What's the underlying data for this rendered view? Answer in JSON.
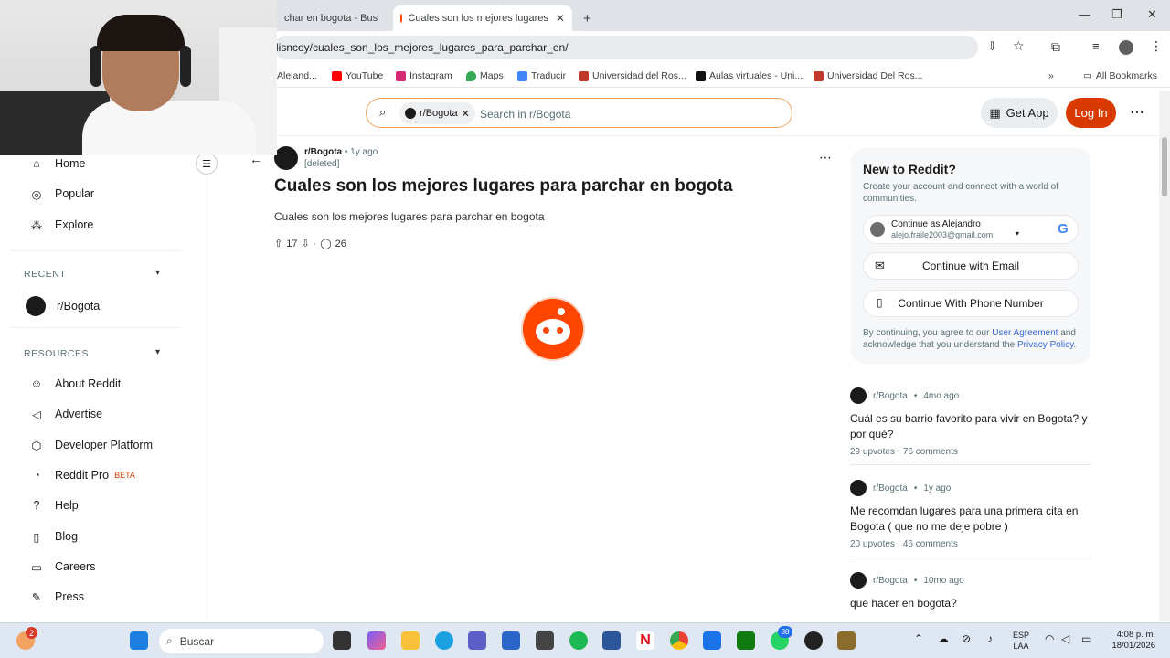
{
  "browser": {
    "tabs": [
      {
        "title": "char en bogota - Bus"
      },
      {
        "title": "Cuales son los mejores lugares"
      }
    ],
    "new_tab": "+",
    "url": "lisncoy/cuales_son_los_mejores_lugares_para_parchar_en/",
    "bookmarks": [
      {
        "label": "Alejand...",
        "color": "#777777"
      },
      {
        "label": "YouTube",
        "color": "#ff0000"
      },
      {
        "label": "Instagram",
        "color": "#d62976"
      },
      {
        "label": "Maps",
        "color": "#34a853"
      },
      {
        "label": "Traducir",
        "color": "#4285f4"
      },
      {
        "label": "Universidad del Ros...",
        "color": "#c0392b"
      },
      {
        "label": "Aulas virtuales - Uni...",
        "color": "#111111"
      },
      {
        "label": "Universidad Del Ros...",
        "color": "#c0392b"
      }
    ],
    "all_bookmarks": "All Bookmarks"
  },
  "reddit_header": {
    "community_chip": "r/Bogota",
    "search_placeholder": "Search in r/Bogota",
    "get_app": "Get App",
    "login": "Log In"
  },
  "sidebar": {
    "top_items": [
      {
        "label": "Home",
        "icon": "home-icon"
      },
      {
        "label": "Popular",
        "icon": "popular-icon"
      },
      {
        "label": "Explore",
        "icon": "explore-icon"
      }
    ],
    "recent_header": "RECENT",
    "recent_items": [
      {
        "label": "r/Bogota"
      }
    ],
    "resources_header": "RESOURCES",
    "resource_items": [
      {
        "label": "About Reddit"
      },
      {
        "label": "Advertise"
      },
      {
        "label": "Developer Platform"
      },
      {
        "label": "Reddit Pro",
        "badge": "BETA"
      },
      {
        "label": "Help"
      },
      {
        "label": "Blog"
      },
      {
        "label": "Careers"
      },
      {
        "label": "Press"
      }
    ]
  },
  "post": {
    "subreddit": "r/Bogota",
    "age": "1y ago",
    "author": "[deleted]",
    "title": "Cuales son los mejores lugares para parchar en bogota",
    "body": "Cuales son los mejores lugares para parchar en bogota",
    "votes": "17",
    "comments": "26",
    "more": "..."
  },
  "new_to_reddit": {
    "title": "New to Reddit?",
    "subtitle": "Create your account and connect with a world of communities.",
    "google_name": "Continue as Alejandro",
    "google_email": "alejo.fraile2003@gmail.com",
    "email_btn": "Continue with Email",
    "phone_btn": "Continue With Phone Number",
    "legal_pre": "By continuing, you agree to our ",
    "legal_link1": "User Agreement",
    "legal_mid": " and acknowledge that you understand the ",
    "legal_link2": "Privacy Policy",
    "legal_end": "."
  },
  "related_posts": [
    {
      "subreddit": "r/Bogota",
      "age": "4mo ago",
      "title": "Cuál es su barrio favorito para vivir en Bogota? y por qué?",
      "upvotes": "29 upvotes",
      "comments": "76 comments"
    },
    {
      "subreddit": "r/Bogota",
      "age": "1y ago",
      "title": "Me recomdan lugares para una primera cita en Bogota ( que no me deje pobre )",
      "upvotes": "20 upvotes",
      "comments": "46 comments"
    },
    {
      "subreddit": "r/Bogota",
      "age": "10mo ago",
      "title": "que hacer en bogota?",
      "upvotes": "",
      "comments": ""
    }
  ],
  "taskbar": {
    "search_placeholder": "Buscar",
    "notif_count": "2",
    "whatsapp_count": "88",
    "lang_top": "ESP",
    "lang_bottom": "LAA",
    "time": "4:08 p. m.",
    "date": "18/01/2026"
  },
  "colors": {
    "reddit_orange": "#d93a00",
    "link_blue": "#3a6ad6"
  }
}
